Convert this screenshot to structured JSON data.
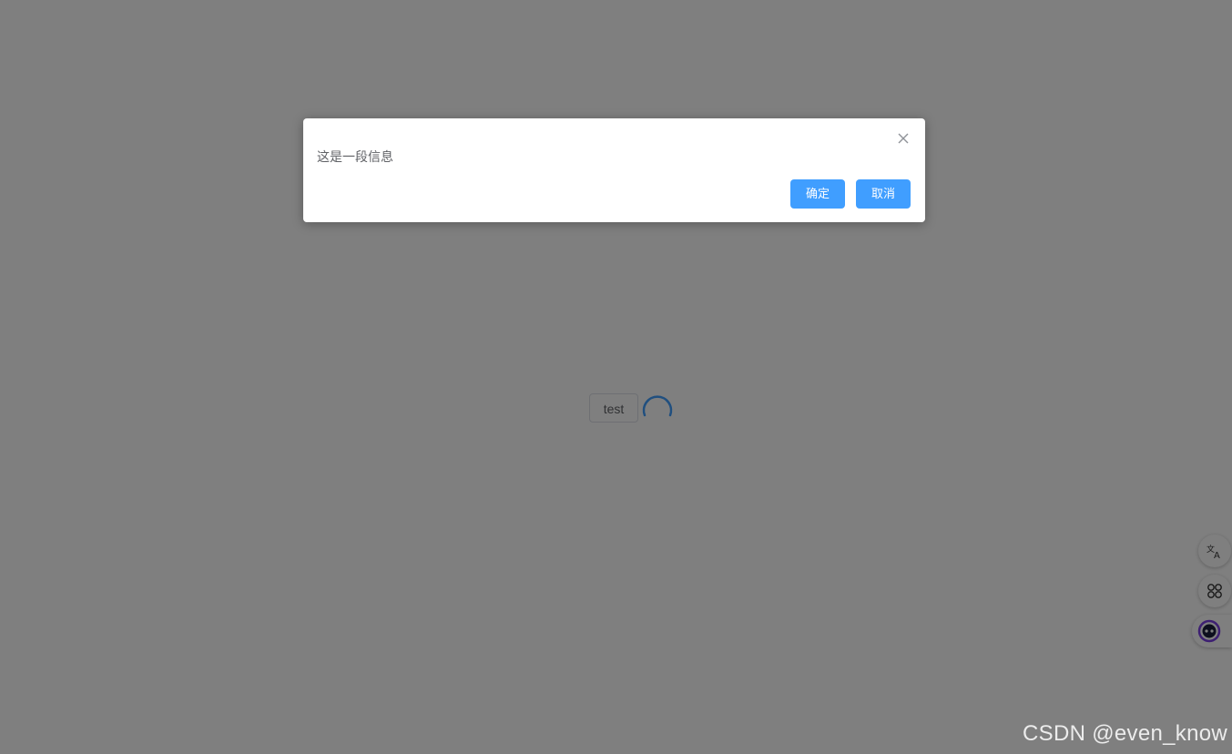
{
  "page": {
    "test_button_label": "test"
  },
  "side_tools": {
    "translate_icon": "translate-icon",
    "apps_icon": "apps-grid-icon",
    "assistant_icon": "assistant-robot-icon"
  },
  "dialog": {
    "message": "这是一段信息",
    "confirm_label": "确定",
    "cancel_label": "取消",
    "close_icon": "close-icon"
  },
  "watermark": "CSDN @even_know",
  "colors": {
    "primary": "#409eff",
    "mask": "rgba(0,0,0,0.5)",
    "text": "#606266",
    "spinner": "#409eff"
  }
}
